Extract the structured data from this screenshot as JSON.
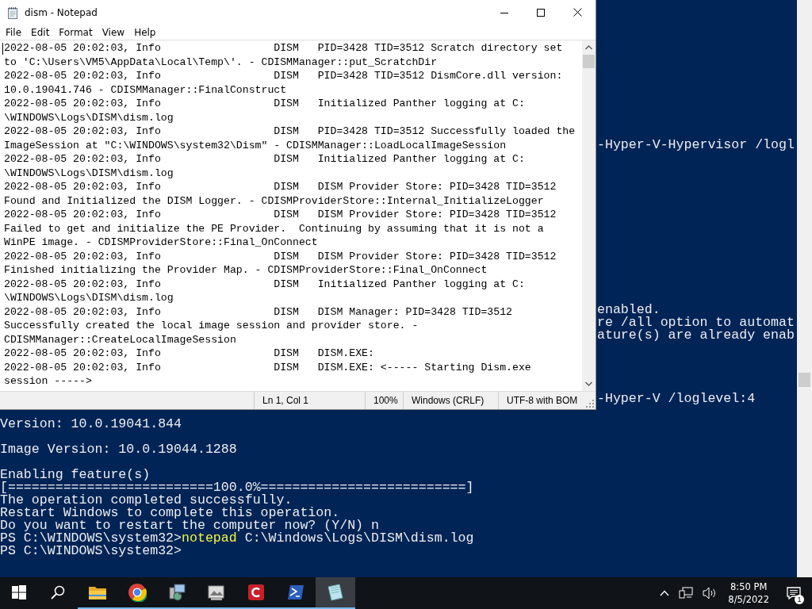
{
  "console": {
    "lines": [
      {
        "kind": "blank"
      },
      {
        "kind": "blank"
      },
      {
        "kind": "blank"
      },
      {
        "kind": "blank"
      },
      {
        "kind": "blank"
      },
      {
        "kind": "blank"
      },
      {
        "kind": "blank"
      },
      {
        "kind": "blank"
      },
      {
        "kind": "blank"
      },
      {
        "kind": "blank"
      },
      {
        "kind": "fragment",
        "text": "-Hyper-V-Hypervisor /logl"
      },
      {
        "kind": "blank"
      },
      {
        "kind": "blank"
      },
      {
        "kind": "blank"
      },
      {
        "kind": "blank"
      },
      {
        "kind": "blank"
      },
      {
        "kind": "blank"
      },
      {
        "kind": "blank"
      },
      {
        "kind": "blank"
      },
      {
        "kind": "blank"
      },
      {
        "kind": "blank"
      },
      {
        "kind": "blank"
      },
      {
        "kind": "blank"
      },
      {
        "kind": "fragment",
        "text": "enabled."
      },
      {
        "kind": "fragment",
        "text": "re /all option to automat"
      },
      {
        "kind": "fragment",
        "text": "ature(s) are already enab"
      },
      {
        "kind": "blank"
      },
      {
        "kind": "blank"
      },
      {
        "kind": "blank"
      },
      {
        "kind": "blank"
      },
      {
        "kind": "fragment",
        "text": "-Hyper-V /loglevel:4"
      },
      {
        "kind": "blank"
      },
      {
        "kind": "line",
        "text": "Version: 10.0.19041.844"
      },
      {
        "kind": "blank"
      },
      {
        "kind": "line",
        "text": "Image Version: 10.0.19044.1288"
      },
      {
        "kind": "blank"
      },
      {
        "kind": "line",
        "text": "Enabling feature(s)"
      },
      {
        "kind": "line",
        "text": "[==========================100.0%==========================]"
      },
      {
        "kind": "line",
        "text": "The operation completed successfully."
      },
      {
        "kind": "line",
        "text": "Restart Windows to complete this operation."
      },
      {
        "kind": "line",
        "text": "Do you want to restart the computer now? (Y/N) n"
      },
      {
        "kind": "command",
        "prompt": "PS C:\\WINDOWS\\system32>",
        "command": "notepad",
        "args": "C:\\Windows\\Logs\\DISM\\dism.log"
      },
      {
        "kind": "line",
        "text": "PS C:\\WINDOWS\\system32>"
      }
    ]
  },
  "notepad": {
    "title": "dism - Notepad",
    "menu": [
      "File",
      "Edit",
      "Format",
      "View",
      "Help"
    ],
    "lines": [
      "2022-08-05 20:02:03, Info                  DISM   PID=3428 TID=3512 Scratch directory set",
      "to 'C:\\Users\\VM5\\AppData\\Local\\Temp\\'. - CDISMManager::put_ScratchDir",
      "2022-08-05 20:02:03, Info                  DISM   PID=3428 TID=3512 DismCore.dll version:",
      "10.0.19041.746 - CDISMManager::FinalConstruct",
      "2022-08-05 20:02:03, Info                  DISM   Initialized Panther logging at C:",
      "\\WINDOWS\\Logs\\DISM\\dism.log",
      "2022-08-05 20:02:03, Info                  DISM   PID=3428 TID=3512 Successfully loaded the",
      "ImageSession at \"C:\\WINDOWS\\system32\\Dism\" - CDISMManager::LoadLocalImageSession",
      "2022-08-05 20:02:03, Info                  DISM   Initialized Panther logging at C:",
      "\\WINDOWS\\Logs\\DISM\\dism.log",
      "2022-08-05 20:02:03, Info                  DISM   DISM Provider Store: PID=3428 TID=3512",
      "Found and Initialized the DISM Logger. - CDISMProviderStore::Internal_InitializeLogger",
      "2022-08-05 20:02:03, Info                  DISM   DISM Provider Store: PID=3428 TID=3512",
      "Failed to get and initialize the PE Provider.  Continuing by assuming that it is not a",
      "WinPE image. - CDISMProviderStore::Final_OnConnect",
      "2022-08-05 20:02:03, Info                  DISM   DISM Provider Store: PID=3428 TID=3512",
      "Finished initializing the Provider Map. - CDISMProviderStore::Final_OnConnect",
      "2022-08-05 20:02:03, Info                  DISM   Initialized Panther logging at C:",
      "\\WINDOWS\\Logs\\DISM\\dism.log",
      "2022-08-05 20:02:03, Info                  DISM   DISM Manager: PID=3428 TID=3512",
      "Successfully created the local image session and provider store. -",
      "CDISMManager::CreateLocalImageSession",
      "2022-08-05 20:02:03, Info                  DISM   DISM.EXE:",
      "2022-08-05 20:02:03, Info                  DISM   DISM.EXE: <----- Starting Dism.exe",
      "session ----->"
    ],
    "status": [
      "Ln 1, Col 1",
      "100%",
      "Windows (CRLF)",
      "UTF-8 with BOM"
    ]
  },
  "taskbar": {
    "items": [
      {
        "kind": "start",
        "running": false,
        "selected": false
      },
      {
        "kind": "search",
        "running": false,
        "selected": false
      },
      {
        "kind": "folder",
        "running": true,
        "selected": false
      },
      {
        "kind": "browser",
        "running": true,
        "selected": false
      },
      {
        "kind": "tools",
        "running": true,
        "selected": false
      },
      {
        "kind": "viewer",
        "running": true,
        "selected": false
      },
      {
        "kind": "app",
        "running": true,
        "selected": false
      },
      {
        "kind": "terminal",
        "running": true,
        "selected": false
      },
      {
        "kind": "notepad",
        "running": true,
        "selected": true
      }
    ],
    "time": "8:50 PM",
    "date": "8/5/2022",
    "notifications": "1"
  }
}
